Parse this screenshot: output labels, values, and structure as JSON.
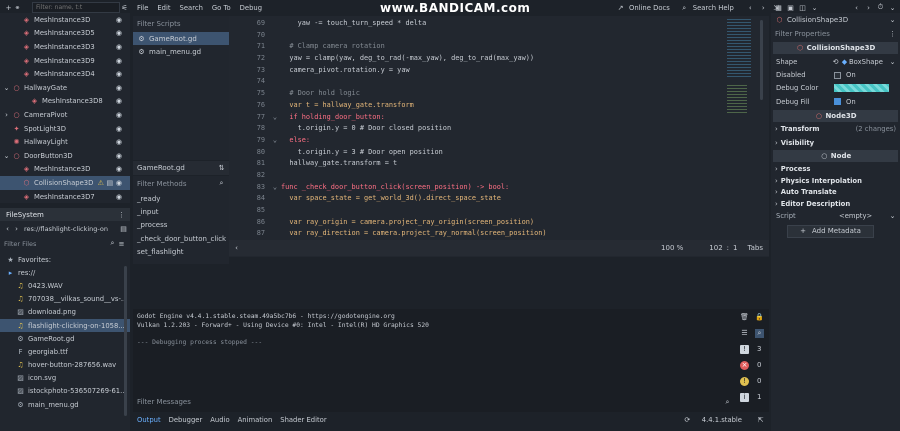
{
  "watermark": "www.BANDICAM.com",
  "scene_filter": {
    "placeholder": "Filter: name, t:t"
  },
  "scene_tree": [
    {
      "label": "MeshInstance3D",
      "icon": "mesh-icon",
      "color": "#e0707a"
    },
    {
      "label": "MeshInstance3D5",
      "icon": "mesh-icon",
      "color": "#e0707a"
    },
    {
      "label": "MeshInstance3D3",
      "icon": "mesh-icon",
      "color": "#e0707a"
    },
    {
      "label": "MeshInstance3D9",
      "icon": "mesh-icon",
      "color": "#e0707a"
    },
    {
      "label": "MeshInstance3D4",
      "icon": "mesh-icon",
      "color": "#e0707a"
    },
    {
      "label": "HallwayGate",
      "icon": "node3d-icon",
      "color": "#e0707a"
    },
    {
      "label": "MeshInstance3D8",
      "icon": "mesh-icon",
      "color": "#e0707a"
    },
    {
      "label": "CameraPivot",
      "icon": "node3d-icon",
      "color": "#e0707a"
    },
    {
      "label": "SpotLight3D",
      "icon": "spotlight-icon",
      "color": "#e0707a"
    },
    {
      "label": "HallwayLight",
      "icon": "light-icon",
      "color": "#e0707a"
    },
    {
      "label": "DoorButton3D",
      "icon": "node3d-icon",
      "color": "#e0707a"
    },
    {
      "label": "MeshInstance3D",
      "icon": "mesh-icon",
      "color": "#e0707a"
    },
    {
      "label": "CollisionShape3D",
      "icon": "collision-icon",
      "color": "#e0707a"
    },
    {
      "label": "MeshInstance3D7",
      "icon": "mesh-icon",
      "color": "#e0707a"
    }
  ],
  "filesystem": {
    "title": "FileSystem",
    "path": "res://flashlight-clicking-on",
    "filter_placeholder": "Filter Files",
    "items": [
      {
        "label": "Favorites:",
        "icon": "star-icon"
      },
      {
        "label": "res://",
        "icon": "folder-icon"
      },
      {
        "label": "0423.WAV",
        "icon": "audio-icon"
      },
      {
        "label": "707038__vilkas_sound__vs-...",
        "icon": "audio-icon"
      },
      {
        "label": "download.png",
        "icon": "image-icon"
      },
      {
        "label": "flashlight-clicking-on-1058...",
        "icon": "audio-icon"
      },
      {
        "label": "GameRoot.gd",
        "icon": "script-icon"
      },
      {
        "label": "georgiab.ttf",
        "icon": "font-icon"
      },
      {
        "label": "hover-button-287656.wav",
        "icon": "audio-icon"
      },
      {
        "label": "icon.svg",
        "icon": "image-icon"
      },
      {
        "label": "istockphoto-536507269-61...",
        "icon": "image-icon"
      },
      {
        "label": "main_menu.gd",
        "icon": "script-icon"
      }
    ]
  },
  "menu": [
    "File",
    "Edit",
    "Search",
    "Go To",
    "Debug"
  ],
  "toolbar": {
    "online_docs": "Online Docs",
    "search_help": "Search Help"
  },
  "scripts": {
    "filter_placeholder": "Filter Scripts",
    "items": [
      "GameRoot.gd",
      "main_menu.gd"
    ],
    "current": "GameRoot.gd"
  },
  "methods": {
    "filter_placeholder": "Filter Methods",
    "items": [
      "_ready",
      "_input",
      "_process",
      "_check_door_button_click",
      "set_flashlight"
    ]
  },
  "code": [
    {
      "n": "69",
      "fold": "",
      "text": "\t\tyaw -= touch_turn_speed * delta"
    },
    {
      "n": "70",
      "fold": "",
      "text": ""
    },
    {
      "n": "71",
      "fold": "",
      "text": "\t# Clamp camera rotation"
    },
    {
      "n": "72",
      "fold": "",
      "text": "\tyaw = clamp(yaw, deg_to_rad(-max_yaw), deg_to_rad(max_yaw))"
    },
    {
      "n": "73",
      "fold": "",
      "text": "\tcamera_pivot.rotation.y = yaw"
    },
    {
      "n": "74",
      "fold": "",
      "text": ""
    },
    {
      "n": "75",
      "fold": "",
      "text": "\t# Door hold logic"
    },
    {
      "n": "76",
      "fold": "",
      "text": "\tvar t = hallway_gate.transform"
    },
    {
      "n": "77",
      "fold": "v",
      "text": "\tif holding_door_button:"
    },
    {
      "n": "78",
      "fold": "",
      "text": "\t\tt.origin.y = 0 # Door closed position"
    },
    {
      "n": "79",
      "fold": "v",
      "text": "\telse:"
    },
    {
      "n": "80",
      "fold": "",
      "text": "\t\tt.origin.y = 3 # Door open position"
    },
    {
      "n": "81",
      "fold": "",
      "text": "\thallway_gate.transform = t"
    },
    {
      "n": "82",
      "fold": "",
      "text": ""
    },
    {
      "n": "83",
      "fold": "v",
      "text": "func _check_door_button_click(screen_position) -> bool:"
    },
    {
      "n": "84",
      "fold": "",
      "text": "\tvar space_state = get_world_3d().direct_space_state"
    },
    {
      "n": "85",
      "fold": "",
      "text": ""
    },
    {
      "n": "86",
      "fold": "",
      "text": "\tvar ray_origin = camera.project_ray_origin(screen_position)"
    },
    {
      "n": "87",
      "fold": "",
      "text": "\tvar ray_direction = camera.project_ray_normal(screen_position)"
    }
  ],
  "editor_status": {
    "zoom": "100 %",
    "line": "102",
    "col": "1",
    "indent": "Tabs"
  },
  "output": {
    "lines": [
      "Godot Engine v4.4.1.stable.steam.49a5bc7b6 - https://godotengine.org",
      "Vulkan 1.2.203 - Forward+ - Using Device #0: Intel - Intel(R) HD Graphics 520",
      "",
      "--- Debugging process stopped ---"
    ],
    "filter_placeholder": "Filter Messages",
    "counts": {
      "log": "3",
      "errors": "0",
      "warnings": "0",
      "info": "1"
    }
  },
  "bottom_tabs": [
    "Output",
    "Debugger",
    "Audio",
    "Animation",
    "Shader Editor"
  ],
  "version": "4.4.1.stable",
  "inspector": {
    "node_name": "CollisionShape3D",
    "filter_placeholder": "Filter Properties",
    "class_header": "CollisionShape3D",
    "shape_label": "Shape",
    "shape_value": "BoxShape",
    "disabled_label": "Disabled",
    "disabled_value": "On",
    "debug_color_label": "Debug Color",
    "debug_fill_label": "Debug Fill",
    "debug_fill_value": "On",
    "node3d_header": "Node3D",
    "transform_label": "Transform",
    "transform_changes": "(2 changes)",
    "visibility_label": "Visibility",
    "node_header": "Node",
    "process_label": "Process",
    "physics_label": "Physics Interpolation",
    "auto_translate_label": "Auto Translate",
    "editor_desc_label": "Editor Description",
    "script_label": "Script",
    "script_value": "<empty>",
    "add_metadata": "Add Metadata"
  },
  "colors": {
    "accent": "#4a90d9",
    "selected": "#3d5470",
    "error": "#e05d5d",
    "warning": "#e0c050"
  }
}
